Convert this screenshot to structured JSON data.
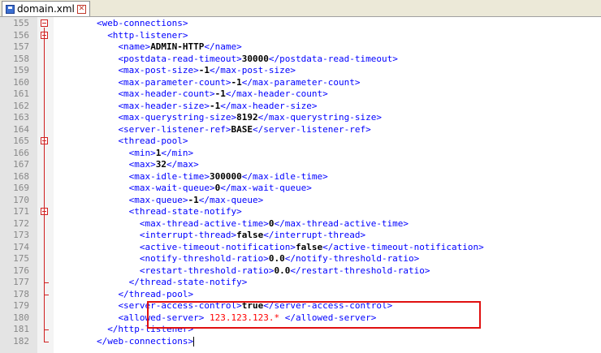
{
  "tab": {
    "label": "domain.xml"
  },
  "lines": [
    {
      "n": "155",
      "indent": 4,
      "tag_open": "<web-connections>",
      "value": "",
      "tag_close": "",
      "style": ""
    },
    {
      "n": "156",
      "indent": 5,
      "tag_open": "<http-listener>",
      "value": "",
      "tag_close": "",
      "style": ""
    },
    {
      "n": "157",
      "indent": 6,
      "tag_open": "<name>",
      "value": "ADMIN-HTTP",
      "tag_close": "</name>",
      "style": ""
    },
    {
      "n": "158",
      "indent": 6,
      "tag_open": "<postdata-read-timeout>",
      "value": "30000",
      "tag_close": "</postdata-read-timeout>",
      "style": ""
    },
    {
      "n": "159",
      "indent": 6,
      "tag_open": "<max-post-size>",
      "value": "-1",
      "tag_close": "</max-post-size>",
      "style": ""
    },
    {
      "n": "160",
      "indent": 6,
      "tag_open": "<max-parameter-count>",
      "value": "-1",
      "tag_close": "</max-parameter-count>",
      "style": ""
    },
    {
      "n": "161",
      "indent": 6,
      "tag_open": "<max-header-count>",
      "value": "-1",
      "tag_close": "</max-header-count>",
      "style": ""
    },
    {
      "n": "162",
      "indent": 6,
      "tag_open": "<max-header-size>",
      "value": "-1",
      "tag_close": "</max-header-size>",
      "style": ""
    },
    {
      "n": "163",
      "indent": 6,
      "tag_open": "<max-querystring-size>",
      "value": "8192",
      "tag_close": "</max-querystring-size>",
      "style": ""
    },
    {
      "n": "164",
      "indent": 6,
      "tag_open": "<server-listener-ref>",
      "value": "BASE",
      "tag_close": "</server-listener-ref>",
      "style": ""
    },
    {
      "n": "165",
      "indent": 6,
      "tag_open": "<thread-pool>",
      "value": "",
      "tag_close": "",
      "style": ""
    },
    {
      "n": "166",
      "indent": 7,
      "tag_open": "<min>",
      "value": "1",
      "tag_close": "</min>",
      "style": ""
    },
    {
      "n": "167",
      "indent": 7,
      "tag_open": "<max>",
      "value": "32",
      "tag_close": "</max>",
      "style": ""
    },
    {
      "n": "168",
      "indent": 7,
      "tag_open": "<max-idle-time>",
      "value": "300000",
      "tag_close": "</max-idle-time>",
      "style": ""
    },
    {
      "n": "169",
      "indent": 7,
      "tag_open": "<max-wait-queue>",
      "value": "0",
      "tag_close": "</max-wait-queue>",
      "style": ""
    },
    {
      "n": "170",
      "indent": 7,
      "tag_open": "<max-queue>",
      "value": "-1",
      "tag_close": "</max-queue>",
      "style": ""
    },
    {
      "n": "171",
      "indent": 7,
      "tag_open": "<thread-state-notify>",
      "value": "",
      "tag_close": "",
      "style": ""
    },
    {
      "n": "172",
      "indent": 8,
      "tag_open": "<max-thread-active-time>",
      "value": "0",
      "tag_close": "</max-thread-active-time>",
      "style": ""
    },
    {
      "n": "173",
      "indent": 8,
      "tag_open": "<interrupt-thread>",
      "value": "false",
      "tag_close": "</interrupt-thread>",
      "style": ""
    },
    {
      "n": "174",
      "indent": 8,
      "tag_open": "<active-timeout-notification>",
      "value": "false",
      "tag_close": "</active-timeout-notification>",
      "style": ""
    },
    {
      "n": "175",
      "indent": 8,
      "tag_open": "<notify-threshold-ratio>",
      "value": "0.0",
      "tag_close": "</notify-threshold-ratio>",
      "style": ""
    },
    {
      "n": "176",
      "indent": 8,
      "tag_open": "<restart-threshold-ratio>",
      "value": "0.0",
      "tag_close": "</restart-threshold-ratio>",
      "style": ""
    },
    {
      "n": "177",
      "indent": 7,
      "tag_open": "</thread-state-notify>",
      "value": "",
      "tag_close": "",
      "style": ""
    },
    {
      "n": "178",
      "indent": 6,
      "tag_open": "</thread-pool>",
      "value": "",
      "tag_close": "",
      "style": ""
    },
    {
      "n": "179",
      "indent": 6,
      "tag_open": "<server-access-control>",
      "value": "true",
      "tag_close": "</server-access-control>",
      "style": ""
    },
    {
      "n": "180",
      "indent": 6,
      "tag_open": "<allowed-server>",
      "value": " 123.123.123.* ",
      "tag_close": "</allowed-server>",
      "style": "red"
    },
    {
      "n": "181",
      "indent": 5,
      "tag_open": "</http-listener>",
      "value": "",
      "tag_close": "",
      "style": ""
    },
    {
      "n": "182",
      "indent": 4,
      "tag_open": "</web-connections>",
      "value": "",
      "tag_close": "",
      "style": ""
    }
  ],
  "colors": {
    "tag": "#0000ff",
    "value": "#000000",
    "highlight": "#e01010",
    "fold": "#d02020"
  }
}
